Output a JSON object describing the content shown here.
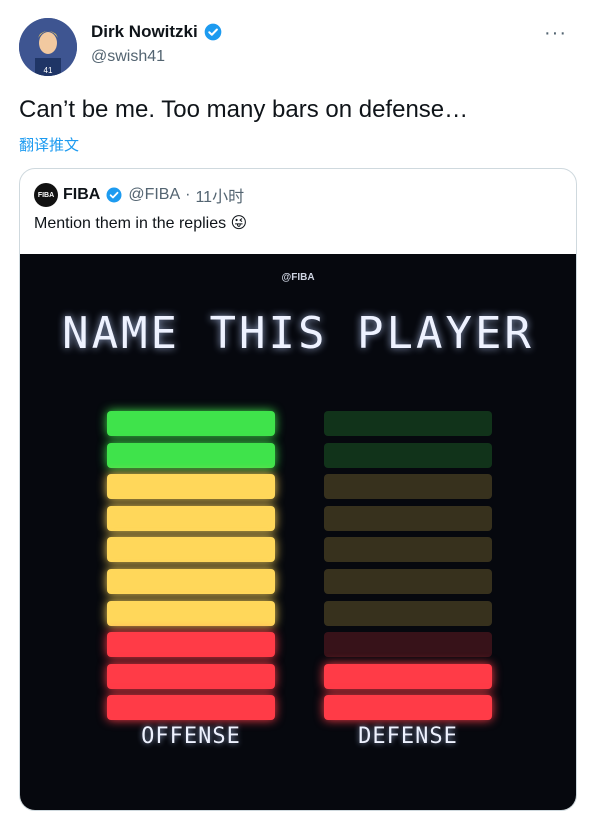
{
  "tweet": {
    "author_name": "Dirk Nowitzki",
    "author_handle": "@swish41",
    "more_label": "···",
    "text": "Can’t be me. Too many bars on defense…",
    "translate_label": "翻译推文"
  },
  "quote": {
    "logo_text": "FIBA",
    "author_name": "FIBA",
    "author_handle": "@FIBA",
    "separator": "·",
    "time": "11小时",
    "text": "Mention them in the replies 😜",
    "image": {
      "handle": "@FIBA",
      "title": "NAME THIS PLAYER",
      "columns": [
        {
          "label": "OFFENSE",
          "lit_bars": 10
        },
        {
          "label": "DEFENSE",
          "lit_bars": 2
        }
      ],
      "bar_colors": [
        "#3fe34b",
        "#3fe34b",
        "#ffd75a",
        "#ffd75a",
        "#ffd75a",
        "#ffd75a",
        "#ffd75a",
        "#ff3b47",
        "#ff3b47",
        "#ff3b47"
      ]
    }
  },
  "colors": {
    "accent": "#1d9bf0",
    "text": "#0f1419",
    "secondary_text": "#536471"
  },
  "icons": {
    "verified": "verified-badge-icon",
    "more": "more-options-icon",
    "avatar": "avatar"
  }
}
